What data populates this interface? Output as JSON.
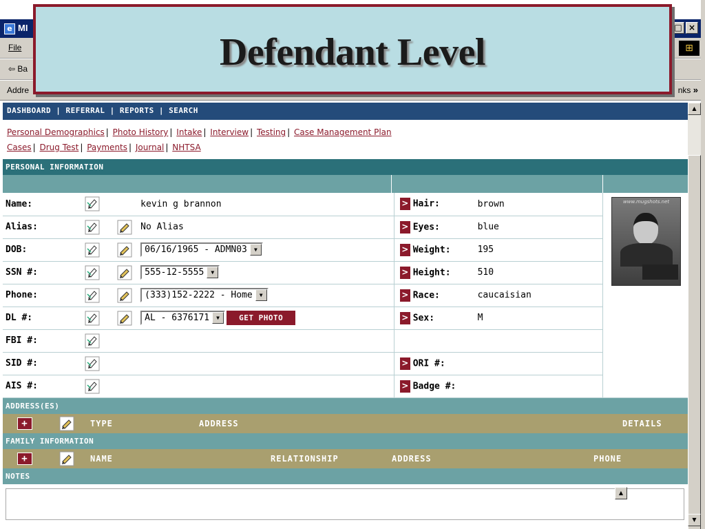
{
  "slide_title": "Defendant Level",
  "browser": {
    "window_title": "MI",
    "menu_file": "File",
    "back_label": "Ba",
    "address_label": "Addre",
    "links_label": "nks",
    "minimize": "_",
    "restore": "□",
    "close": "×"
  },
  "top_nav": {
    "items": [
      "DASHBOARD",
      "REFERRAL",
      "REPORTS",
      "SEARCH"
    ]
  },
  "sub_nav": {
    "row1": [
      "Personal Demographics",
      "Photo History",
      "Intake",
      "Interview",
      "Testing",
      "Case Management Plan"
    ],
    "row2": [
      "Cases",
      "Drug Test",
      "Payments",
      "Journal",
      "NHTSA"
    ]
  },
  "personal_info": {
    "heading": "PERSONAL INFORMATION",
    "left": [
      {
        "label": "Name:",
        "value": "kevin g brannon"
      },
      {
        "label": "Alias:",
        "value": "No Alias"
      },
      {
        "label": "DOB:",
        "value": "06/16/1965 - ADMN03"
      },
      {
        "label": "SSN #:",
        "value": "555-12-5555"
      },
      {
        "label": "Phone:",
        "value": "(333)152-2222 - Home"
      },
      {
        "label": "DL #:",
        "value": "AL - 6376171"
      },
      {
        "label": "FBI #:",
        "value": ""
      },
      {
        "label": "SID #:",
        "value": ""
      },
      {
        "label": "AIS #:",
        "value": ""
      }
    ],
    "right": [
      {
        "label": "Hair:",
        "value": "brown"
      },
      {
        "label": "Eyes:",
        "value": "blue"
      },
      {
        "label": "Weight:",
        "value": "195"
      },
      {
        "label": "Height:",
        "value": "510"
      },
      {
        "label": "Race:",
        "value": "caucaisian"
      },
      {
        "label": "Sex:",
        "value": "M"
      },
      {
        "label": "",
        "value": ""
      },
      {
        "label": "ORI #:",
        "value": ""
      },
      {
        "label": "Badge #:",
        "value": ""
      }
    ],
    "get_photo_label": "GET PHOTO",
    "photo_site_text": "www.mugshots.net"
  },
  "addresses": {
    "heading": "ADDRESS(ES)",
    "add_label": "+",
    "columns": [
      "TYPE",
      "ADDRESS",
      "DETAILS"
    ]
  },
  "family": {
    "heading": "FAMILY INFORMATION",
    "add_label": "+",
    "columns": [
      "NAME",
      "RELATIONSHIP",
      "ADDRESS",
      "PHONE"
    ]
  },
  "notes": {
    "heading": "NOTES",
    "value": ""
  },
  "icons": {
    "arrow": ">",
    "dropdown": "▼",
    "scroll_up": "▲",
    "scroll_down": "▼"
  },
  "colors": {
    "nav_blue": "#244b7a",
    "section_teal": "#2b7079",
    "accent_maroon": "#8b1a2b",
    "header_khaki": "#a99f6f",
    "banner_bg": "#b9dde3"
  }
}
